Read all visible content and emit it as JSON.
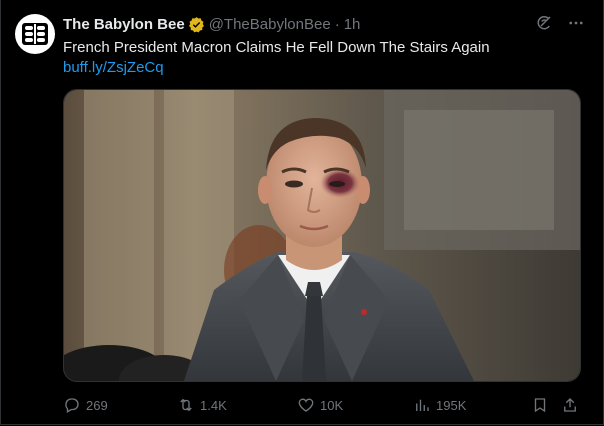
{
  "tweet": {
    "author_name": "The Babylon Bee",
    "handle": "@TheBabylonBee",
    "separator": "·",
    "time": "1h",
    "text": "French President Macron Claims He Fell Down The Stairs Again",
    "link": "buff.ly/ZsjZeCq"
  },
  "actions": {
    "replies": "269",
    "reposts": "1.4K",
    "likes": "10K",
    "views": "195K"
  },
  "colors": {
    "background": "#000000",
    "text": "#e7e9ea",
    "muted": "#71767b",
    "link": "#1d9bf0",
    "verified_badge": "#e2b719",
    "border": "#2f3336"
  },
  "icons": {
    "avatar": "babylon-bee-logo",
    "verified": "verified-badge-icon",
    "grok": "grok-icon",
    "more": "more-icon",
    "reply": "reply-icon",
    "repost": "repost-icon",
    "like": "heart-icon",
    "views": "views-icon",
    "bookmark": "bookmark-icon",
    "share": "share-icon"
  }
}
